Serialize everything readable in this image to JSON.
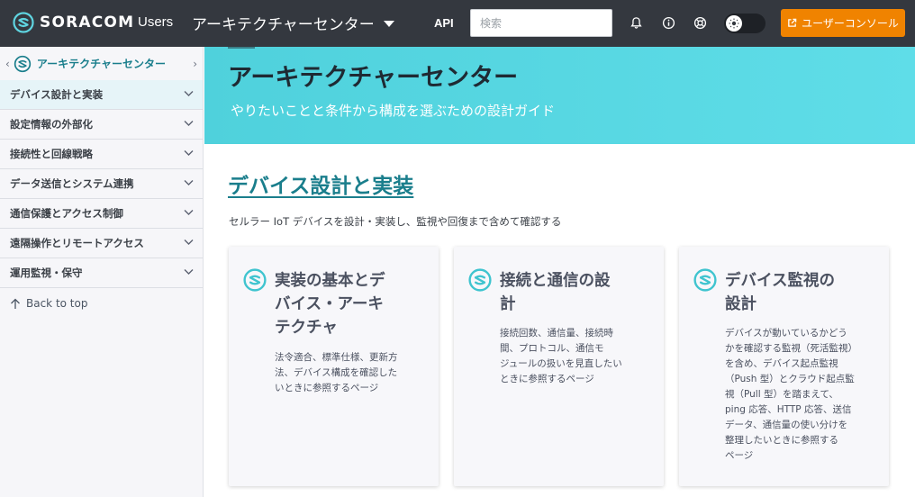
{
  "topbar": {
    "brand": "SORACOM",
    "users_label": "Users",
    "section_selector": "アーキテクチャーセンター",
    "api_link": "API",
    "search_placeholder": "検索",
    "console_button": "ユーザーコンソール",
    "accent_color": "#f08300",
    "icons": [
      "bell-icon",
      "info-icon",
      "support-icon",
      "theme-toggle-sun-icon",
      "external-link-icon"
    ]
  },
  "sidebar": {
    "header_title": "アーキテクチャーセンター",
    "items": [
      {
        "label": "デバイス設計と実装"
      },
      {
        "label": "設定情報の外部化"
      },
      {
        "label": "接続性と回線戦略"
      },
      {
        "label": "データ送信とシステム連携"
      },
      {
        "label": "通信保護とアクセス制御"
      },
      {
        "label": "遠隔操作とリモートアクセス"
      },
      {
        "label": "運用監視・保守"
      }
    ],
    "back_to_top": "Back to top"
  },
  "hero": {
    "title": "アーキテクチャーセンター",
    "subtitle": "やりたいことと条件から構成を選ぶための設計ガイド"
  },
  "section": {
    "title": "デバイス設計と実装",
    "description": "セルラー IoT デバイスを設計・実装し、監視や回復まで含めて確認する"
  },
  "cards": [
    {
      "title_lines": [
        "実装の基本とデ",
        "バイス・アーキ",
        "テクチャ"
      ],
      "desc_lines": [
        "法令適合、標準仕様、更新方",
        "法、デバイス構成を確認した",
        "いときに参照するページ"
      ]
    },
    {
      "title_lines": [
        "接続と通信の設",
        "計"
      ],
      "desc_lines": [
        "接続回数、通信量、接続時",
        "間、プロトコル、通信モ",
        "ジュールの扱いを見直したい",
        "ときに参照するページ"
      ]
    },
    {
      "title_lines": [
        "デバイス監視の",
        "設計"
      ],
      "desc_lines": [
        "デバイスが動いているかどう",
        "かを確認する監視（死活監視）",
        "を含め、デバイス起点監視",
        "（Push 型）とクラウド起点監",
        "視（Pull 型）を踏まえて、",
        "ping 応答、HTTP 応答、送信",
        "データ、通信量の使い分けを",
        "整理したいときに参照する",
        "ページ"
      ]
    }
  ]
}
